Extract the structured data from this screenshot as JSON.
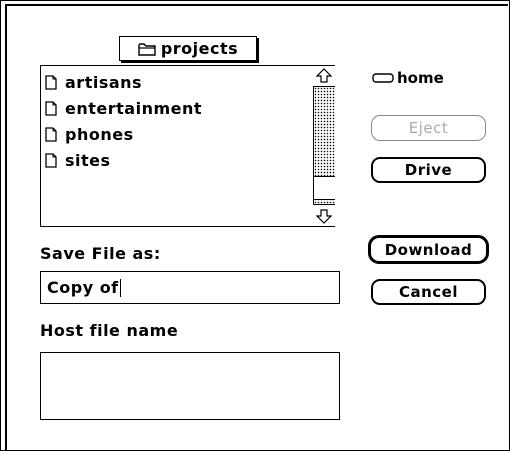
{
  "folder_popup": {
    "label": "projects",
    "icon": "folder-icon"
  },
  "file_list": {
    "items": [
      {
        "name": "artisans",
        "icon": "document-icon"
      },
      {
        "name": "entertainment",
        "icon": "document-icon"
      },
      {
        "name": "phones",
        "icon": "document-icon"
      },
      {
        "name": "sites",
        "icon": "document-icon"
      }
    ]
  },
  "drive": {
    "label": "home",
    "icon": "disk-icon"
  },
  "buttons": {
    "eject": "Eject",
    "drive": "Drive",
    "download": "Download",
    "cancel": "Cancel"
  },
  "save": {
    "label": "Save File as:",
    "value": "Copy of"
  },
  "host": {
    "label": "Host file name",
    "value": ""
  }
}
